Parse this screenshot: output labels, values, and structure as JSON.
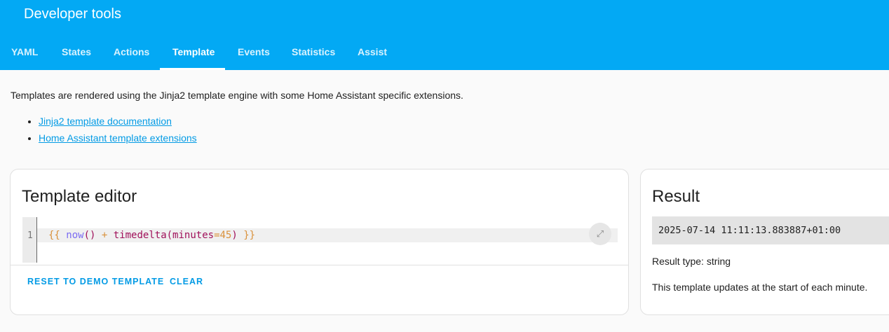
{
  "header": {
    "title": "Developer tools",
    "tabs": [
      "YAML",
      "States",
      "Actions",
      "Template",
      "Events",
      "Statistics",
      "Assist"
    ],
    "active_tab": "Template"
  },
  "intro": {
    "text": "Templates are rendered using the Jinja2 template engine with some Home Assistant specific extensions.",
    "links": [
      "Jinja2 template documentation",
      "Home Assistant template extensions"
    ]
  },
  "editor": {
    "title": "Template editor",
    "line_number": "1",
    "code": {
      "open": "{{",
      "func": "now",
      "parens": "()",
      "plus": "+",
      "call": "timedelta(minutes",
      "eq": "=",
      "num": "45",
      "rparen": ")",
      "close": "}}"
    },
    "reset_label": "RESET TO DEMO TEMPLATE",
    "clear_label": "CLEAR",
    "expand_icon": "expand-icon"
  },
  "result": {
    "title": "Result",
    "value": "2025-07-14 11:11:13.883887+01:00",
    "type_text": "Result type: string",
    "update_text": "This template updates at the start of each minute."
  },
  "colors": {
    "header": "#03a9f4",
    "link": "#039be5"
  }
}
